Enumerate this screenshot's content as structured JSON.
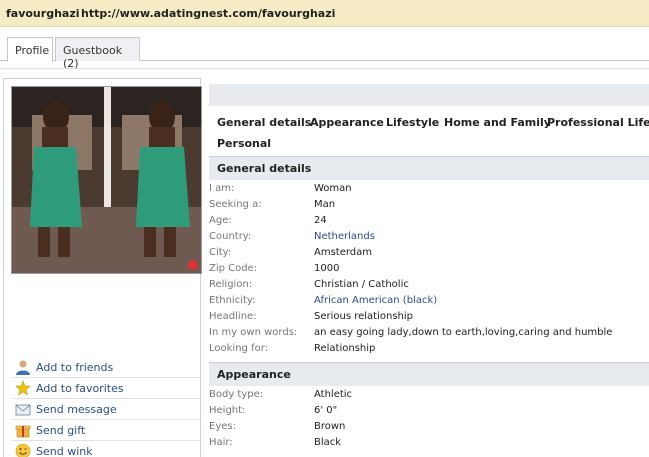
{
  "header": {
    "username": "favourghazi",
    "url": "http://www.adatingnest.com/favourghazi"
  },
  "tabs": [
    {
      "label": "Profile"
    },
    {
      "label": "Guestbook (2)"
    }
  ],
  "actions": [
    {
      "label": "Add to friends",
      "icon": "user-icon"
    },
    {
      "label": "Add to favorites",
      "icon": "star-icon"
    },
    {
      "label": "Send message",
      "icon": "envelope-icon"
    },
    {
      "label": "Send gift",
      "icon": "gift-icon"
    },
    {
      "label": "Send wink",
      "icon": "smiley-icon"
    }
  ],
  "section_tabs": [
    "General details",
    "Appearance",
    "Lifestyle",
    "Home and Family",
    "Professional Life",
    "Personal"
  ],
  "general": {
    "title": "General details",
    "rows": [
      {
        "k": "I am:",
        "v": "Woman"
      },
      {
        "k": "Seeking a:",
        "v": "Man"
      },
      {
        "k": "Age:",
        "v": "24"
      },
      {
        "k": "Country:",
        "v": "Netherlands"
      },
      {
        "k": "City:",
        "v": "Amsterdam"
      },
      {
        "k": "Zip Code:",
        "v": "1000"
      },
      {
        "k": "Religion:",
        "v": "Christian / Catholic"
      },
      {
        "k": "Ethnicity:",
        "v": "African American (black)"
      },
      {
        "k": "Headline:",
        "v": "Serious relationship"
      },
      {
        "k": "In my own words:",
        "v": "an easy going lady,down to earth,loving,caring and humble"
      },
      {
        "k": "Looking for:",
        "v": "Relationship"
      }
    ]
  },
  "appearance": {
    "title": "Appearance",
    "rows": [
      {
        "k": "Body type:",
        "v": "Athletic"
      },
      {
        "k": "Height:",
        "v": "6' 0\""
      },
      {
        "k": "Eyes:",
        "v": "Brown"
      },
      {
        "k": "Hair:",
        "v": "Black"
      }
    ]
  },
  "colors": {
    "topbar": "#f5ecc6",
    "link": "#2a4f88",
    "section_bg": "#e7ebf0",
    "dress": "#2e9c7b"
  }
}
